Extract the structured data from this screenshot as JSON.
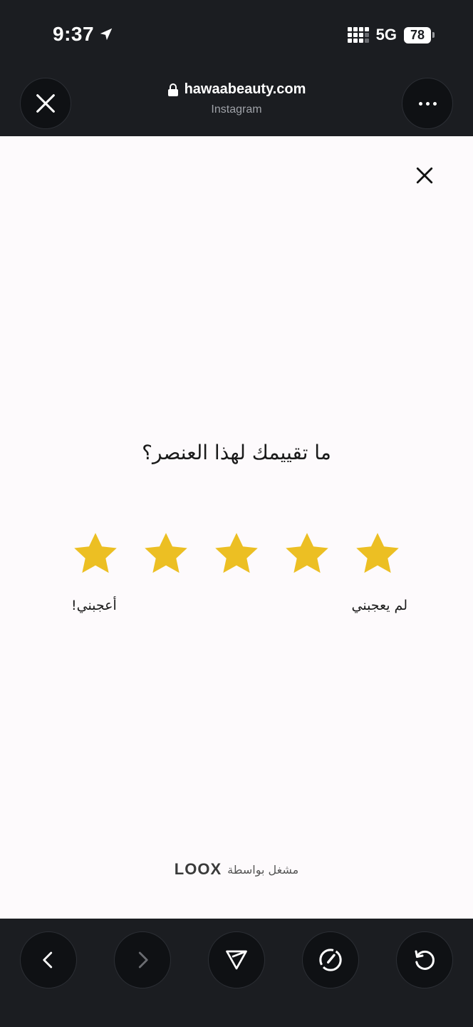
{
  "status_bar": {
    "time": "9:37",
    "network": "5G",
    "battery": "78"
  },
  "browser": {
    "domain": "hawaabeauty.com",
    "subtitle": "Instagram",
    "icons": {
      "close": "close-icon",
      "more": "more-icon",
      "lock": "lock-icon"
    }
  },
  "review": {
    "question": "ما تقييمك لهذا العنصر؟",
    "stars": [
      1,
      2,
      3,
      4,
      5
    ],
    "star_color": "#ecbf23",
    "label_low": "لم يعجبني",
    "label_high": "أعجبني!",
    "powered_by": "مشغل بواسطة",
    "brand": "LOOX"
  },
  "bottom_nav": {
    "icons": [
      "back-icon",
      "forward-icon",
      "share-icon",
      "speed-icon",
      "reload-icon"
    ]
  }
}
